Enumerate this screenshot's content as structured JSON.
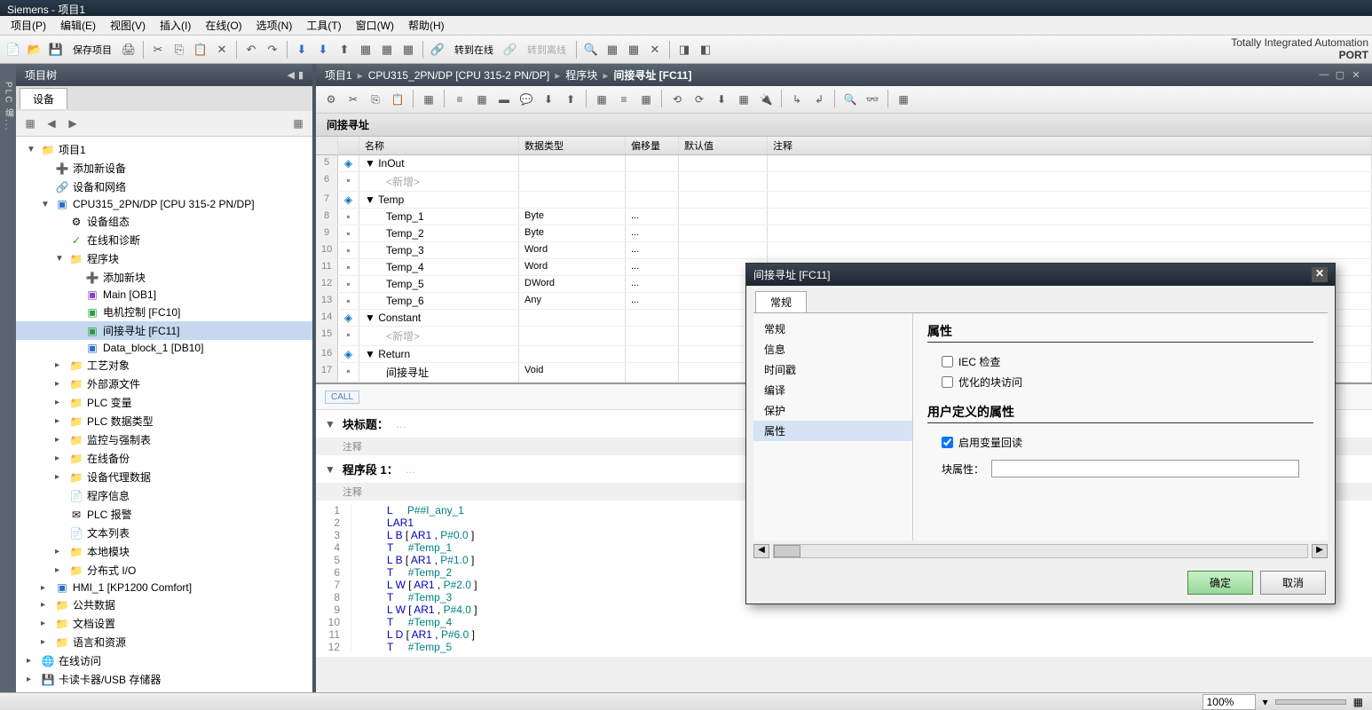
{
  "app": {
    "title": "Siemens  -  项目1"
  },
  "menu": [
    "项目(P)",
    "编辑(E)",
    "视图(V)",
    "插入(I)",
    "在线(O)",
    "选项(N)",
    "工具(T)",
    "窗口(W)",
    "帮助(H)"
  ],
  "toolbar": {
    "save_label": "保存项目",
    "go_online": "转到在线",
    "go_offline": "转到离线",
    "brand_line1": "Totally Integrated Automation",
    "brand_line2": "PORT"
  },
  "tree": {
    "title": "项目树",
    "devices_tab": "设备",
    "nodes": {
      "project": "项目1",
      "add_device": "添加新设备",
      "devices_networks": "设备和网络",
      "cpu": "CPU315_2PN/DP [CPU 315-2 PN/DP]",
      "device_config": "设备组态",
      "online_diag": "在线和诊断",
      "program_blocks": "程序块",
      "add_block": "添加新块",
      "main": "Main [OB1]",
      "motor": "电机控制 [FC10]",
      "indirect": "间接寻址 [FC11]",
      "datablock": "Data_block_1 [DB10]",
      "tech_objects": "工艺对象",
      "ext_source": "外部源文件",
      "plc_vars": "PLC 变量",
      "plc_types": "PLC 数据类型",
      "watch_force": "监控与强制表",
      "online_backup": "在线备份",
      "proxy_data": "设备代理数据",
      "prog_info": "程序信息",
      "plc_alarm": "PLC 报警",
      "text_list": "文本列表",
      "local_modules": "本地模块",
      "io_dist": "分布式 I/O",
      "hmi": "HMI_1 [KP1200 Comfort]",
      "common_data": "公共数据",
      "doc_settings": "文档设置",
      "lang_res": "语言和资源",
      "online_access": "在线访问",
      "card_reader": "卡读卡器/USB 存储器"
    }
  },
  "breadcrumb": {
    "p1": "项目1",
    "p2": "CPU315_2PN/DP [CPU 315-2 PN/DP]",
    "p3": "程序块",
    "p4": "间接寻址 [FC11]"
  },
  "block_label": "间接寻址",
  "var_headers": {
    "name": "名称",
    "type": "数据类型",
    "offset": "偏移量",
    "default": "默认值",
    "comment": "注释"
  },
  "var_rows": [
    {
      "n": 5,
      "lvl": 0,
      "name": "InOut",
      "type": "",
      "off": "",
      "def": ""
    },
    {
      "n": 6,
      "lvl": 1,
      "name": "<新增>",
      "type": "",
      "off": "",
      "def": "",
      "ph": true
    },
    {
      "n": 7,
      "lvl": 0,
      "name": "Temp",
      "type": "",
      "off": "",
      "def": ""
    },
    {
      "n": 8,
      "lvl": 1,
      "name": "Temp_1",
      "type": "Byte",
      "off": "...",
      "def": ""
    },
    {
      "n": 9,
      "lvl": 1,
      "name": "Temp_2",
      "type": "Byte",
      "off": "...",
      "def": ""
    },
    {
      "n": 10,
      "lvl": 1,
      "name": "Temp_3",
      "type": "Word",
      "off": "...",
      "def": ""
    },
    {
      "n": 11,
      "lvl": 1,
      "name": "Temp_4",
      "type": "Word",
      "off": "...",
      "def": ""
    },
    {
      "n": 12,
      "lvl": 1,
      "name": "Temp_5",
      "type": "DWord",
      "off": "...",
      "def": ""
    },
    {
      "n": 13,
      "lvl": 1,
      "name": "Temp_6",
      "type": "Any",
      "off": "...",
      "def": ""
    },
    {
      "n": 14,
      "lvl": 0,
      "name": "Constant",
      "type": "",
      "off": "",
      "def": ""
    },
    {
      "n": 15,
      "lvl": 1,
      "name": "<新增>",
      "type": "",
      "off": "",
      "def": "",
      "ph": true
    },
    {
      "n": 16,
      "lvl": 0,
      "name": "Return",
      "type": "",
      "off": "",
      "def": ""
    },
    {
      "n": 17,
      "lvl": 1,
      "name": "间接寻址",
      "type": "Void",
      "off": "",
      "def": ""
    }
  ],
  "code": {
    "call": "CALL",
    "block_title_label": "块标题：",
    "comment_label": "注释",
    "segment_label": "程序段 1：",
    "lines": [
      {
        "n": 1,
        "t": "L     P##I_any_1"
      },
      {
        "n": 2,
        "t": "LAR1"
      },
      {
        "n": 3,
        "t": "L B [ AR1 , P#0.0 ]"
      },
      {
        "n": 4,
        "t": "T     #Temp_1"
      },
      {
        "n": 5,
        "t": "L B [ AR1 , P#1.0 ]"
      },
      {
        "n": 6,
        "t": "T     #Temp_2"
      },
      {
        "n": 7,
        "t": "L W [ AR1 , P#2.0 ]"
      },
      {
        "n": 8,
        "t": "T     #Temp_3"
      },
      {
        "n": 9,
        "t": "L W [ AR1 , P#4.0 ]"
      },
      {
        "n": 10,
        "t": "T     #Temp_4"
      },
      {
        "n": 11,
        "t": "L D [ AR1 , P#6.0 ]"
      },
      {
        "n": 12,
        "t": "T     #Temp_5"
      }
    ]
  },
  "dialog": {
    "title": "间接寻址 [FC11]",
    "tab": "常规",
    "nav": [
      "常规",
      "信息",
      "时间戳",
      "编译",
      "保护",
      "属性"
    ],
    "section1": "属性",
    "check_iec": "IEC 检查",
    "check_opt": "优化的块访问",
    "section2": "用户定义的属性",
    "check_readback": "启用变量回读",
    "field_label": "块属性：",
    "ok": "确定",
    "cancel": "取消"
  },
  "status": {
    "zoom": "100%"
  }
}
